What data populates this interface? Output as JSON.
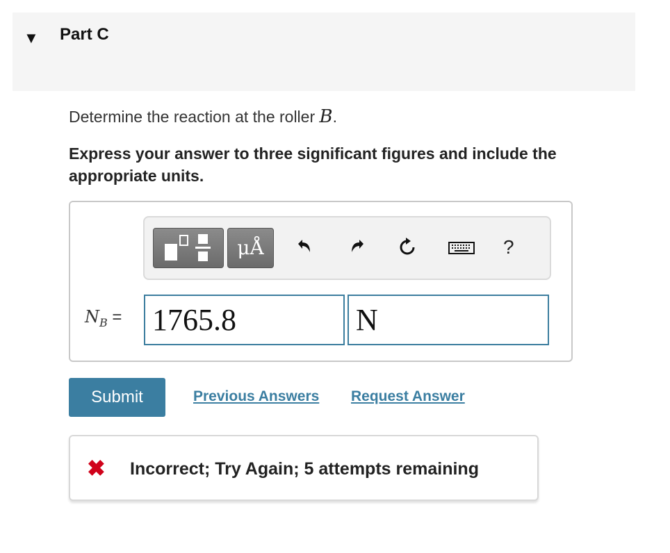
{
  "header": {
    "toggle_icon": "caret-down-icon",
    "title": "Part C"
  },
  "prompt": {
    "text": "Determine the reaction at the roller ",
    "variable": "B",
    "suffix": "."
  },
  "instructions": "Express your answer to three significant figures and include the appropriate units.",
  "toolbar": {
    "templates_icon": "templates-icon",
    "units_label": "μÅ",
    "undo_icon": "undo-icon",
    "redo_icon": "redo-icon",
    "reset_icon": "reset-icon",
    "keyboard_icon": "keyboard-icon",
    "help_label": "?"
  },
  "answer": {
    "label_var": "N",
    "label_sub": "B",
    "label_eq": " =",
    "value": "1765.8",
    "unit": "N"
  },
  "actions": {
    "submit": "Submit",
    "previous_answers": "Previous Answers",
    "request_answer": "Request Answer"
  },
  "feedback": {
    "icon": "x-icon",
    "text": "Incorrect; Try Again; 5 attempts remaining",
    "color": "#d0021b"
  },
  "colors": {
    "accent": "#3b7ea1",
    "header_bg": "#f5f5f5"
  }
}
